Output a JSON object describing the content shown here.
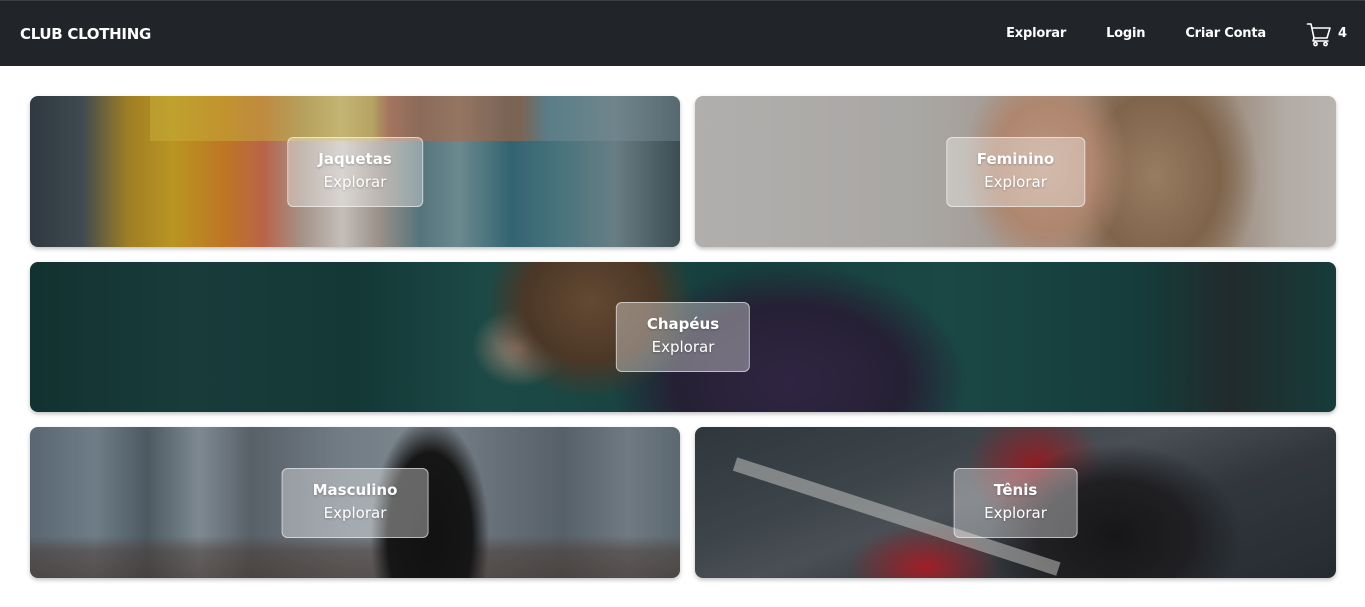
{
  "header": {
    "brand": "CLUB CLOTHING",
    "nav": [
      {
        "label": "Explorar"
      },
      {
        "label": "Login"
      },
      {
        "label": "Criar Conta"
      }
    ],
    "cart": {
      "icon": "cart-icon",
      "count": "4"
    }
  },
  "categories": [
    {
      "title": "Jaquetas",
      "action": "Explorar"
    },
    {
      "title": "Feminino",
      "action": "Explorar"
    },
    {
      "title": "Chapéus",
      "action": "Explorar"
    },
    {
      "title": "Masculino",
      "action": "Explorar"
    },
    {
      "title": "Tênis",
      "action": "Explorar"
    }
  ],
  "colors": {
    "header_bg": "#212429",
    "header_text": "#ffffff",
    "page_bg": "#ffffff"
  }
}
